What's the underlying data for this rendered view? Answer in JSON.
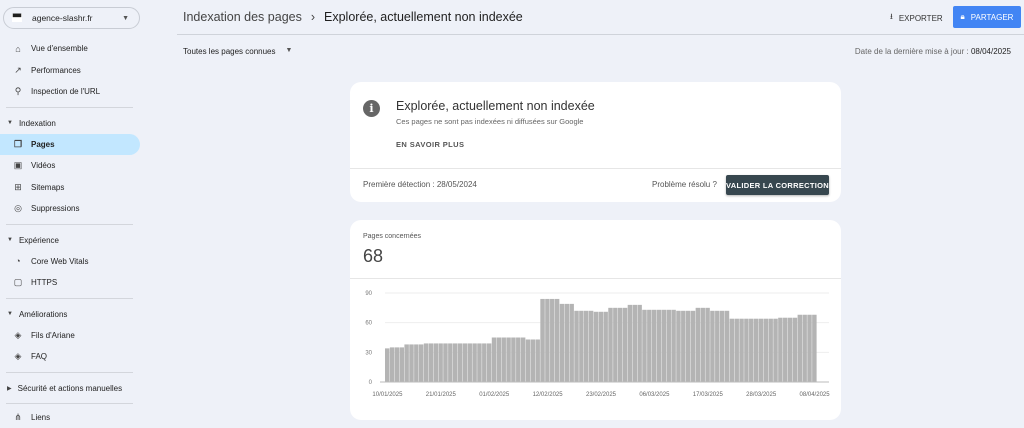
{
  "sidebar": {
    "property": "agence-slashr.fr",
    "top_items": [
      {
        "label": "Vue d'ensemble",
        "icon": "home-icon"
      },
      {
        "label": "Performances",
        "icon": "trending-icon"
      },
      {
        "label": "Inspection de l'URL",
        "icon": "search-icon"
      }
    ],
    "sections": [
      {
        "label": "Indexation",
        "items": [
          {
            "label": "Pages",
            "icon": "pages-icon",
            "active": true
          },
          {
            "label": "Vidéos",
            "icon": "video-icon"
          },
          {
            "label": "Sitemaps",
            "icon": "sitemap-icon"
          },
          {
            "label": "Suppressions",
            "icon": "eye-off-icon"
          }
        ]
      },
      {
        "label": "Expérience",
        "items": [
          {
            "label": "Core Web Vitals",
            "icon": "gauge-icon"
          },
          {
            "label": "HTTPS",
            "icon": "lock-icon"
          }
        ]
      },
      {
        "label": "Améliorations",
        "items": [
          {
            "label": "Fils d'Ariane",
            "icon": "layers-icon"
          },
          {
            "label": "FAQ",
            "icon": "layers-icon"
          }
        ]
      },
      {
        "label": "Sécurité et actions manuelles",
        "items": []
      }
    ],
    "bottom_items": [
      {
        "label": "Liens",
        "icon": "links-icon"
      }
    ]
  },
  "header": {
    "breadcrumb_parent": "Indexation des pages",
    "breadcrumb_current": "Explorée, actuellement non indexée",
    "export": "EXPORTER",
    "share": "PARTAGER",
    "accent": "#4285f4"
  },
  "filter": {
    "selected": "Toutes les pages connues",
    "last_update_label": "Date de la dernière mise à jour :",
    "last_update": "08/04/2025"
  },
  "issue": {
    "title": "Explorée, actuellement non indexée",
    "description": "Ces pages ne sont pas indexées ni diffusées sur Google",
    "learn_more": "EN SAVOIR PLUS",
    "first_detected": "Première détection : 28/05/2024",
    "solved_question": "Problème résolu ?",
    "validate": "VALIDER LA CORRECTION"
  },
  "pages": {
    "label": "Pages concernées",
    "count": "68"
  },
  "chart_data": {
    "type": "bar",
    "ylim": [
      0,
      90
    ],
    "yticks": [
      0,
      30,
      60,
      90
    ],
    "grid": true,
    "xticks": [
      "10/01/2025",
      "21/01/2025",
      "01/02/2025",
      "12/02/2025",
      "23/02/2025",
      "06/03/2025",
      "17/03/2025",
      "28/03/2025",
      "08/04/2025"
    ],
    "x": [
      "10/01/2025",
      "11/01/2025",
      "12/01/2025",
      "13/01/2025",
      "14/01/2025",
      "15/01/2025",
      "16/01/2025",
      "17/01/2025",
      "18/01/2025",
      "19/01/2025",
      "20/01/2025",
      "21/01/2025",
      "22/01/2025",
      "23/01/2025",
      "24/01/2025",
      "25/01/2025",
      "26/01/2025",
      "27/01/2025",
      "28/01/2025",
      "29/01/2025",
      "30/01/2025",
      "31/01/2025",
      "01/02/2025",
      "02/02/2025",
      "03/02/2025",
      "04/02/2025",
      "05/02/2025",
      "06/02/2025",
      "07/02/2025",
      "08/02/2025",
      "09/02/2025",
      "10/02/2025",
      "11/02/2025",
      "12/02/2025",
      "13/02/2025",
      "14/02/2025",
      "15/02/2025",
      "16/02/2025",
      "17/02/2025",
      "18/02/2025",
      "19/02/2025",
      "20/02/2025",
      "21/02/2025",
      "22/02/2025",
      "23/02/2025",
      "24/02/2025",
      "25/02/2025",
      "26/02/2025",
      "27/02/2025",
      "28/02/2025",
      "01/03/2025",
      "02/03/2025",
      "03/03/2025",
      "04/03/2025",
      "05/03/2025",
      "06/03/2025",
      "07/03/2025",
      "08/03/2025",
      "09/03/2025",
      "10/03/2025",
      "11/03/2025",
      "12/03/2025",
      "13/03/2025",
      "14/03/2025",
      "15/03/2025",
      "16/03/2025",
      "17/03/2025",
      "18/03/2025",
      "19/03/2025",
      "20/03/2025",
      "21/03/2025",
      "22/03/2025",
      "23/03/2025",
      "24/03/2025",
      "25/03/2025",
      "26/03/2025",
      "27/03/2025",
      "28/03/2025",
      "29/03/2025",
      "30/03/2025",
      "31/03/2025",
      "01/04/2025",
      "02/04/2025",
      "03/04/2025",
      "04/04/2025",
      "05/04/2025",
      "06/04/2025",
      "07/04/2025",
      "08/04/2025"
    ],
    "values": [
      34,
      35,
      35,
      35,
      38,
      38,
      38,
      38,
      39,
      39,
      39,
      39,
      39,
      39,
      39,
      39,
      39,
      39,
      39,
      39,
      39,
      39,
      45,
      45,
      45,
      45,
      45,
      45,
      45,
      43,
      43,
      43,
      84,
      84,
      84,
      84,
      79,
      79,
      79,
      72,
      72,
      72,
      72,
      71,
      71,
      71,
      75,
      75,
      75,
      75,
      78,
      78,
      78,
      73,
      73,
      73,
      73,
      73,
      73,
      73,
      72,
      72,
      72,
      72,
      75,
      75,
      75,
      72,
      72,
      72,
      72,
      64,
      64,
      64,
      64,
      64,
      64,
      64,
      64,
      64,
      64,
      65,
      65,
      65,
      65,
      68,
      68,
      68,
      68
    ],
    "bar_color": "#b4b4b4"
  }
}
